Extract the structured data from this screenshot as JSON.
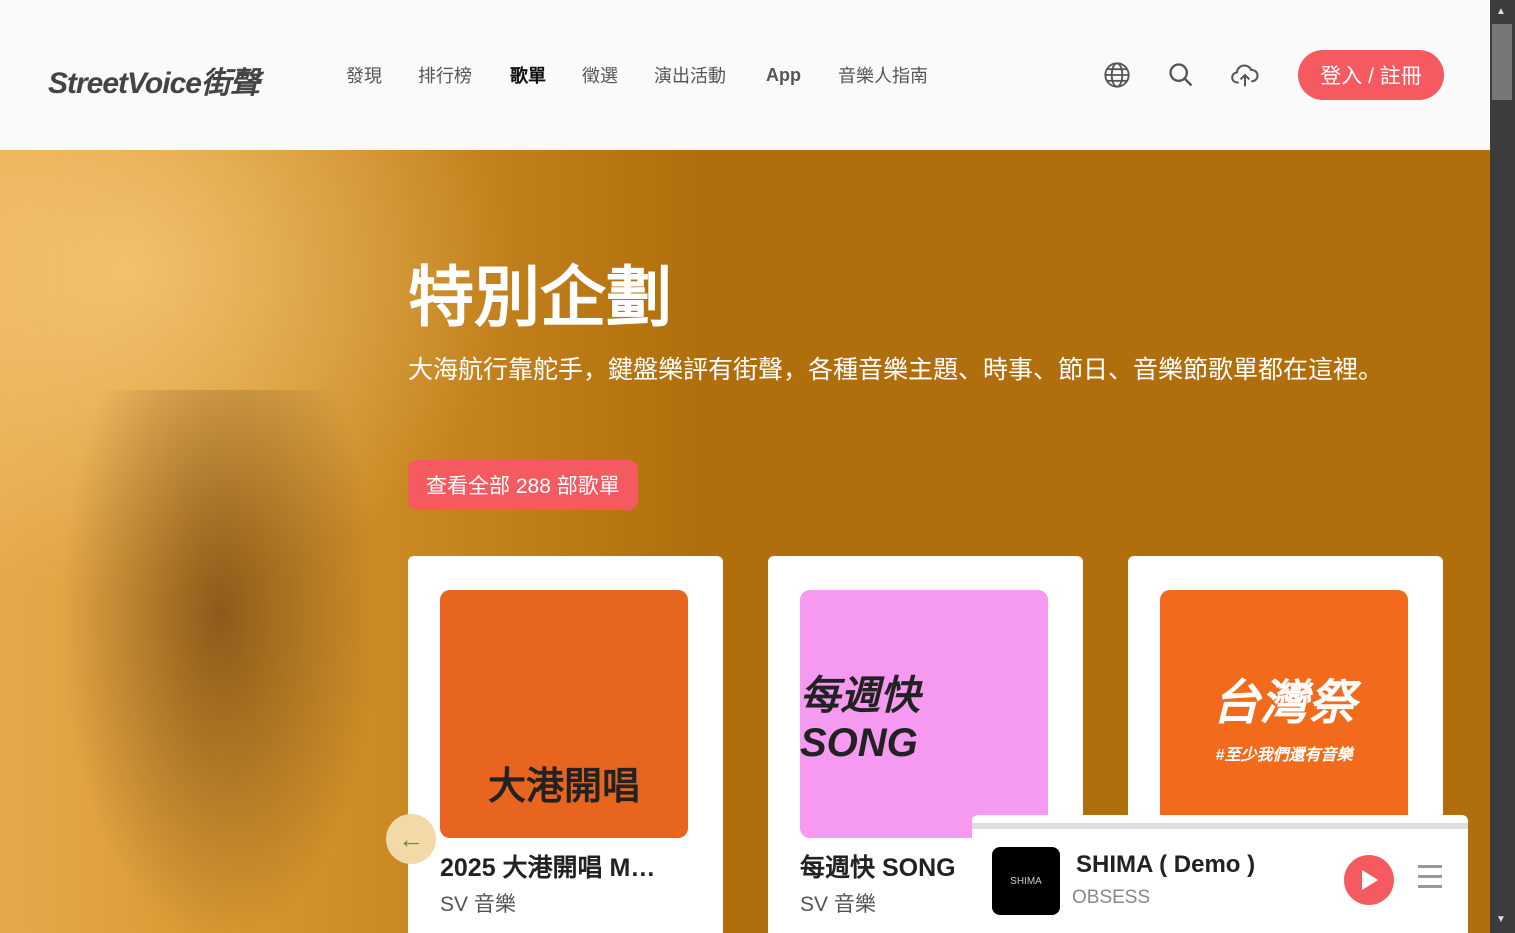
{
  "header": {
    "logo": "StreetVoice街聲",
    "nav": [
      "發現",
      "排行榜",
      "歌單",
      "徵選",
      "演出活動",
      "App",
      "音樂人指南"
    ],
    "active_nav": "歌單",
    "login": "登入 / 註冊"
  },
  "hero": {
    "title": "特別企劃",
    "description": "大海航行靠舵手，鍵盤樂評有街聲，各種音樂主題、時事、節日、音樂節歌單都在這裡。",
    "cta": "查看全部 288 部歌單"
  },
  "cards": [
    {
      "art_text": "大港開唱",
      "title": "2025 大港開唱 M…",
      "artist": "SV 音樂",
      "color": "#e8651f"
    },
    {
      "art_text": "每週快 SONG",
      "title": "每週快 SONG",
      "artist": "SV 音樂",
      "color": "#f59af0"
    },
    {
      "art_text": "台灣祭",
      "art_sub": "#至少我們還有音樂",
      "color": "#f26a1b"
    }
  ],
  "player": {
    "cover_text": "SHIMA",
    "title": "SHIMA ( Demo )",
    "artist": "OBSESS"
  },
  "colors": {
    "accent": "#f55a60",
    "hero_bg": "#b06f0c"
  }
}
